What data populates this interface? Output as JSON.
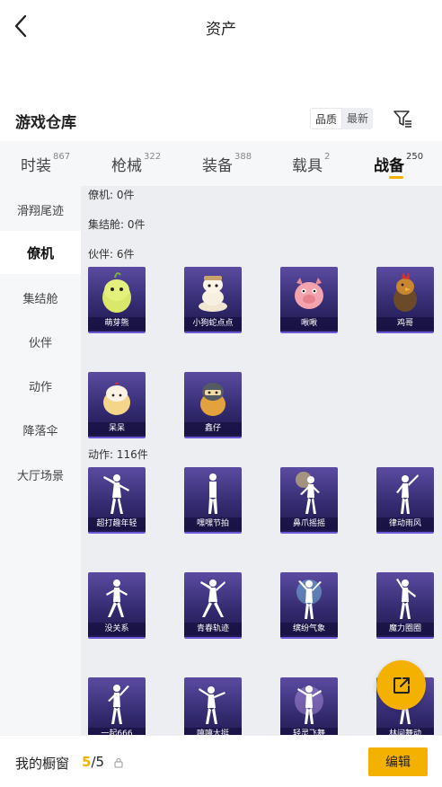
{
  "header": {
    "title": "资产"
  },
  "section": {
    "title": "游戏仓库",
    "sort_options": [
      "品质",
      "最新"
    ]
  },
  "tabs": [
    {
      "label": "时装",
      "count": "867"
    },
    {
      "label": "枪械",
      "count": "322"
    },
    {
      "label": "装备",
      "count": "388"
    },
    {
      "label": "载具",
      "count": "2"
    },
    {
      "label": "战备",
      "count": "250"
    }
  ],
  "sidebar": [
    {
      "label": "滑翔尾迹"
    },
    {
      "label": "僚机"
    },
    {
      "label": "集结舱"
    },
    {
      "label": "伙伴"
    },
    {
      "label": "动作"
    },
    {
      "label": "降落伞"
    },
    {
      "label": "大厅场景"
    }
  ],
  "groups": {
    "wingman": "僚机: 0件",
    "capsule": "集结舱: 0件",
    "partner": "伙伴: 6件",
    "emote": "动作: 116件"
  },
  "partners": [
    "萌芽熊",
    "小狗蛇点点",
    "啾啾",
    "鸡哥",
    "呆呆",
    "鑫仔"
  ],
  "emotes": [
    "超打趣年轻",
    "嘿嘿节拍",
    "鼻爪摇摇",
    "律动雨风",
    "没关系",
    "青春轨迹",
    "缤纷气象",
    "魔力圈圈",
    "一起666",
    "嘻嘻大挺",
    "轻灵飞舞",
    "林间舞动"
  ],
  "footer": {
    "window_label": "我的橱窗",
    "current": "5",
    "total": "/5",
    "edit_label": "编辑"
  },
  "colors": {
    "accent": "#f5b100",
    "card_bg": "#322a6e"
  },
  "icons": {
    "back": "chevron-left-icon",
    "filter": "filter-icon",
    "share": "share-external-icon",
    "lock": "lock-icon"
  }
}
